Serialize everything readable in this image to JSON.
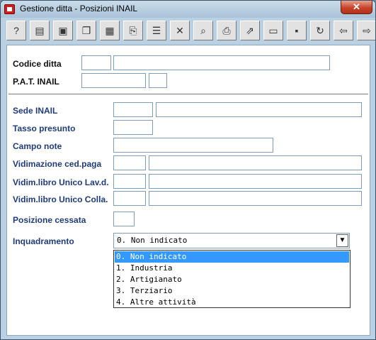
{
  "window": {
    "title": "Gestione ditta - Posizioni INAIL",
    "close_glyph": "✕"
  },
  "toolbar": {
    "buttons": [
      {
        "name": "help",
        "glyph": "?"
      },
      {
        "name": "properties",
        "glyph": "▤"
      },
      {
        "name": "search",
        "glyph": "▣"
      },
      {
        "name": "copy-record",
        "glyph": "❐"
      },
      {
        "name": "calculator",
        "glyph": "▦"
      },
      {
        "name": "copy",
        "glyph": "⎘"
      },
      {
        "name": "list",
        "glyph": "☰"
      },
      {
        "name": "delete",
        "glyph": "✕"
      },
      {
        "name": "preview",
        "glyph": "⌕"
      },
      {
        "name": "print",
        "glyph": "⎙"
      },
      {
        "name": "export",
        "glyph": "⇗"
      },
      {
        "name": "document",
        "glyph": "▭"
      },
      {
        "name": "save",
        "glyph": "▪"
      },
      {
        "name": "refresh",
        "glyph": "↻"
      },
      {
        "name": "back",
        "glyph": "⇦"
      },
      {
        "name": "forward",
        "glyph": "⇨"
      }
    ]
  },
  "form": {
    "codice_ditta": {
      "label": "Codice ditta",
      "code": "",
      "name": ""
    },
    "pat_inail": {
      "label": "P.A.T. INAIL",
      "number": "",
      "suffix": ""
    },
    "sede_inail": {
      "label": "Sede INAIL",
      "code": "",
      "description": ""
    },
    "tasso_presunto": {
      "label": "Tasso presunto",
      "value": ""
    },
    "campo_note": {
      "label": "Campo note",
      "value": ""
    },
    "vidimazione_ced_paga": {
      "label": "Vidimazione ced.paga",
      "code": "",
      "description": ""
    },
    "vidim_libro_lav": {
      "label": "Vidim.libro Unico Lav.d.",
      "code": "",
      "description": ""
    },
    "vidim_libro_colla": {
      "label": "Vidim.libro Unico Colla.",
      "code": "",
      "description": ""
    },
    "posizione_cessata": {
      "label": "Posizione cessata",
      "value": ""
    },
    "inquadramento": {
      "label": "Inquadramento",
      "selected": "0. Non indicato",
      "options": [
        "0. Non indicato",
        "1. Industria",
        "2. Artigianato",
        "3. Terziario",
        "4. Altre attività"
      ]
    }
  }
}
